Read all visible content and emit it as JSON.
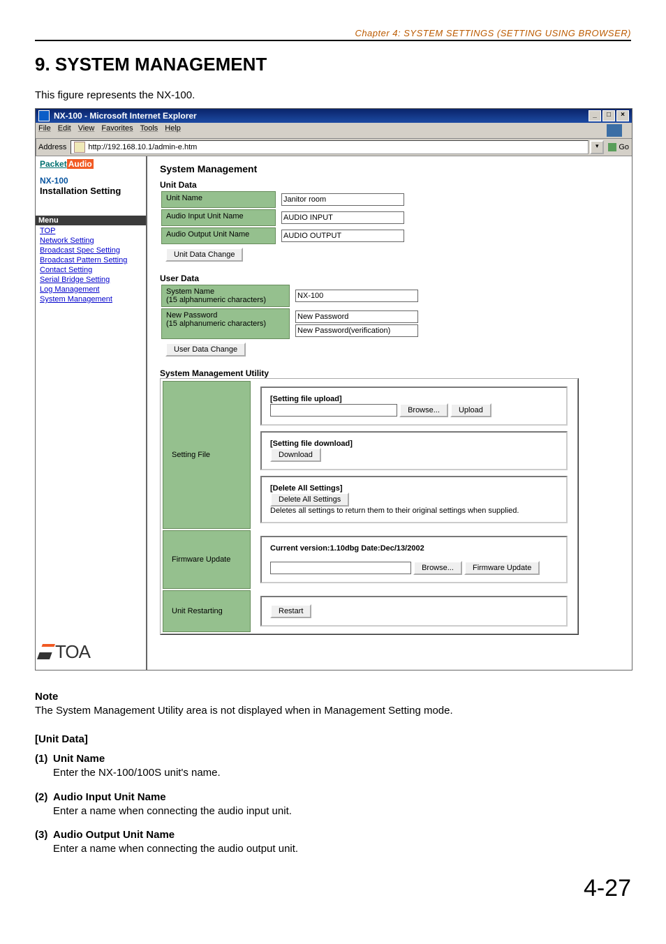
{
  "doc": {
    "chapter_header": "Chapter 4:  SYSTEM SETTINGS (SETTING USING BROWSER)",
    "section_title": "9. SYSTEM MANAGEMENT",
    "intro": "This figure represents the NX-100.",
    "page_number": "4-27"
  },
  "browser": {
    "title": "NX-100 - Microsoft Internet Explorer",
    "menus": {
      "file": "File",
      "edit": "Edit",
      "view": "View",
      "favorites": "Favorites",
      "tools": "Tools",
      "help": "Help"
    },
    "address_label": "Address",
    "url": "http://192.168.10.1/admin-e.htm",
    "go_label": "Go"
  },
  "sidebar": {
    "brand_packet": "Packet",
    "brand_audio": "Audio",
    "model": "NX-100",
    "install": "Installation Setting",
    "menu_header": "Menu",
    "links": {
      "top": "TOP",
      "network": "Network Setting",
      "bcast_spec": "Broadcast Spec Setting",
      "bcast_pattern": "Broadcast Pattern Setting",
      "contact": "Contact Setting",
      "serial": "Serial Bridge Setting",
      "log": "Log Management",
      "system": "System Management"
    },
    "toa_logo": "TOA"
  },
  "main": {
    "title": "System Management",
    "unit_data": {
      "heading": "Unit Data",
      "unit_name_label": "Unit Name",
      "unit_name_value": "Janitor room",
      "audio_in_label": "Audio Input Unit Name",
      "audio_in_value": "AUDIO INPUT",
      "audio_out_label": "Audio Output Unit Name",
      "audio_out_value": "AUDIO OUTPUT",
      "change_btn": "Unit Data Change"
    },
    "user_data": {
      "heading": "User Data",
      "sysname_label": "System Name",
      "sysname_hint": "(15 alphanumeric characters)",
      "sysname_value": "NX-100",
      "newpw_label": "New Password",
      "newpw_hint": "(15 alphanumeric characters)",
      "newpw_placeholder": "New Password",
      "newpw_verify_placeholder": "New Password(verification)",
      "change_btn": "User Data Change"
    },
    "utility": {
      "heading": "System Management Utility",
      "setting_file_label": "Setting File",
      "upload_head": "[Setting file upload]",
      "browse_btn": "Browse...",
      "upload_btn": "Upload",
      "download_head": "[Setting file download]",
      "download_btn": "Download",
      "delete_head": "[Delete All Settings]",
      "delete_btn": "Delete All Settings",
      "delete_note": "Deletes all settings to return them to their original settings when supplied.",
      "fw_label": "Firmware Update",
      "fw_version": "Current version:1.10dbg Date:Dec/13/2002",
      "fw_btn": "Firmware Update",
      "restart_label": "Unit Restarting",
      "restart_btn": "Restart"
    }
  },
  "notes": {
    "note_label": "Note",
    "note_text": "The System Management Utility area is not displayed when in Management Setting mode.",
    "unitdata_head": "[Unit Data]",
    "items": [
      {
        "num": "(1)",
        "term": "Unit Name",
        "desc": "Enter the NX-100/100S unit's name."
      },
      {
        "num": "(2)",
        "term": "Audio Input Unit Name",
        "desc": "Enter a name when connecting the audio input unit."
      },
      {
        "num": "(3)",
        "term": "Audio Output Unit Name",
        "desc": "Enter a name when connecting the audio output unit."
      }
    ]
  }
}
